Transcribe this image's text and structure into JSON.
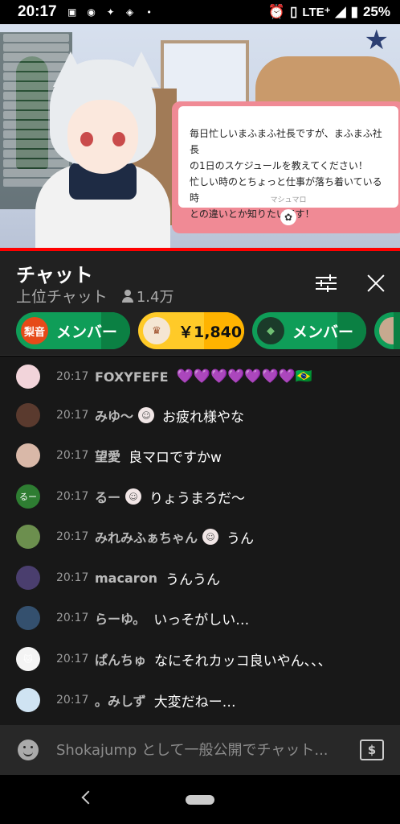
{
  "status_bar": {
    "time": "20:17",
    "network": "LTE⁺",
    "battery": "25%"
  },
  "video": {
    "marshmallow_text_lines": [
      "毎日忙しいまふまふ社長ですが、まふまふ社長",
      "の1日のスケジュールを教えてください！",
      "忙しい時のとちょっと仕事が落ち着いている時",
      "との違いとか知りたいです！"
    ],
    "marshmallow_signature": "マシュマロ"
  },
  "chat": {
    "title": "チャット",
    "mode": "上位チャット",
    "viewer_count": "1.4万",
    "filter_icon": "tune-icon",
    "close_icon": "close-icon"
  },
  "ticker": [
    {
      "avatar_text": "梨音",
      "label": "メンバー",
      "style": "green",
      "avatar_color": "#e64a19"
    },
    {
      "avatar_text": "",
      "label": "￥1,840",
      "style": "gold",
      "avatar_color": "#f5e6d3"
    },
    {
      "avatar_text": "",
      "label": "メンバー",
      "style": "green",
      "avatar_color": "#1b3b2a"
    },
    {
      "avatar_text": "",
      "label": "",
      "style": "green",
      "avatar_color": "#c7a98f"
    }
  ],
  "messages": [
    {
      "time": "20:17",
      "author": "FOXYFEFE",
      "text": "💜💜💜💜💜💜💜🇧🇷",
      "avatar_color": "#f2d4da",
      "avatar_text": "",
      "emoji": false
    },
    {
      "time": "20:17",
      "author": "みゆ〜",
      "text": "お疲れ様やな",
      "avatar_color": "#5a3a2e",
      "avatar_text": "",
      "emoji": true
    },
    {
      "time": "20:17",
      "author": "望愛",
      "text": "良マロですかw",
      "avatar_color": "#d9b8a8",
      "avatar_text": "",
      "emoji": false
    },
    {
      "time": "20:17",
      "author": "るー",
      "text": "りょうまろだ〜",
      "avatar_color": "#2e7d32",
      "avatar_text": "るー",
      "emoji": true
    },
    {
      "time": "20:17",
      "author": "みれみふぁちゃん",
      "text": "うん",
      "avatar_color": "#6c8f4e",
      "avatar_text": "",
      "emoji": true
    },
    {
      "time": "20:17",
      "author": "macaron",
      "text": "うんうん",
      "avatar_color": "#4a3e6e",
      "avatar_text": "",
      "emoji": false
    },
    {
      "time": "20:17",
      "author": "らーゆ。",
      "text": "いっそがしい…",
      "avatar_color": "#34506e",
      "avatar_text": "",
      "emoji": false
    },
    {
      "time": "20:17",
      "author": "ぱんちゅ",
      "text": "なにそれカッコ良いやん、、、",
      "avatar_color": "#f4f4f4",
      "avatar_text": "🐱",
      "emoji": false
    },
    {
      "time": "20:17",
      "author": "。みしず",
      "text": "大変だねー…",
      "avatar_color": "#cfe3f2",
      "avatar_text": "",
      "emoji": false
    }
  ],
  "input": {
    "placeholder": "Shokajump として一般公開でチャット...",
    "money_symbol": "$"
  }
}
